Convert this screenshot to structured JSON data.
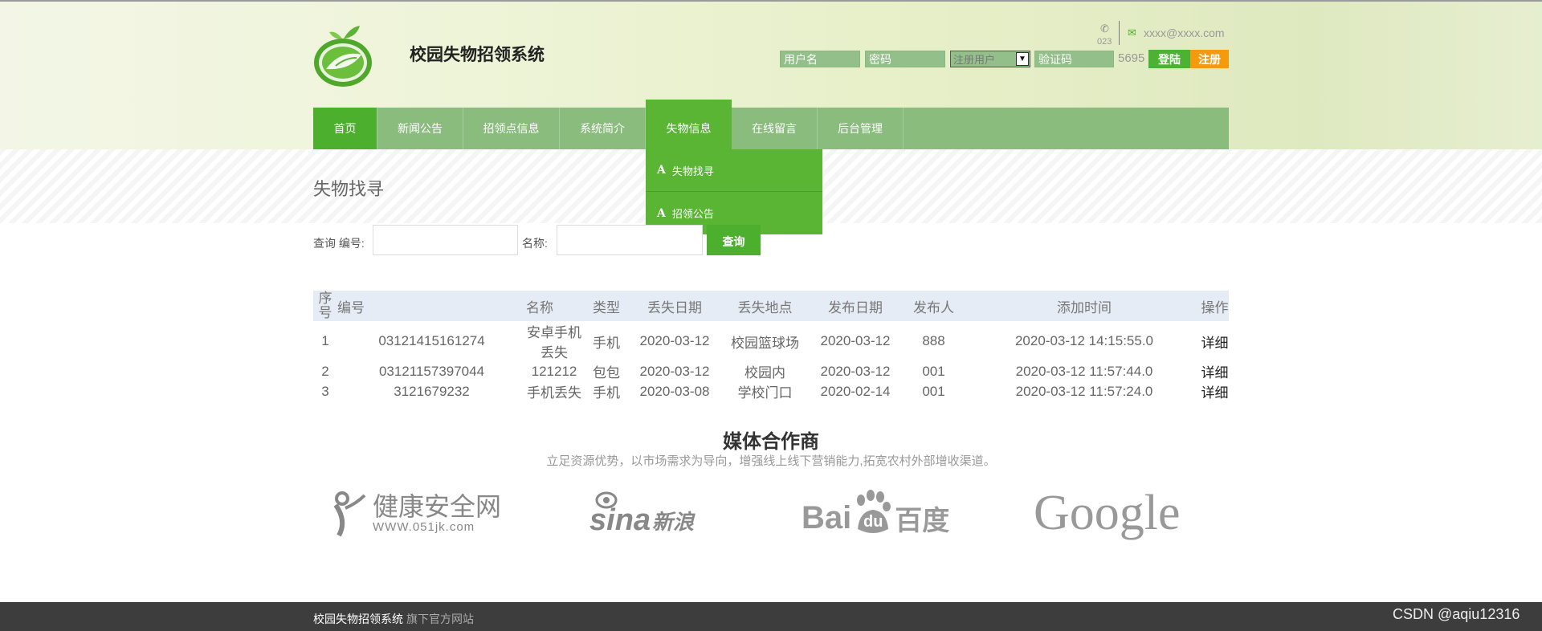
{
  "header": {
    "site_title": "校园失物招领系统",
    "phone_text": "023",
    "email": "xxxx@xxxx.com"
  },
  "login": {
    "username_placeholder": "用户名",
    "password_placeholder": "密码",
    "role_selected": "注册用户",
    "captcha_placeholder": "验证码",
    "captcha_code": "5695",
    "login_label": "登陆",
    "register_label": "注册"
  },
  "nav": {
    "items": [
      "首页",
      "新闻公告",
      "招领点信息",
      "系统简介",
      "失物信息",
      "在线留言",
      "后台管理"
    ],
    "dropdown": [
      "失物找寻",
      "招领公告"
    ]
  },
  "main": {
    "section_title": "失物找寻",
    "search": {
      "label_query_id": "查询 编号:",
      "label_name": "名称:",
      "button": "查询"
    },
    "table": {
      "headers": [
        "序号",
        "编号",
        "名称",
        "类型",
        "丢失日期",
        "丢失地点",
        "发布日期",
        "发布人",
        "添加时间",
        "操作"
      ],
      "rows": [
        [
          "1",
          "03121415161274",
          "安卓手机丢失",
          "手机",
          "2020-03-12",
          "校园篮球场",
          "2020-03-12",
          "888",
          "2020-03-12 14:15:55.0",
          "详细"
        ],
        [
          "2",
          "03121157397044",
          "121212",
          "包包",
          "2020-03-12",
          "校园内",
          "2020-03-12",
          "001",
          "2020-03-12 11:57:44.0",
          "详细"
        ],
        [
          "3",
          "3121679232",
          "手机丢失",
          "手机",
          "2020-03-08",
          "学校门口",
          "2020-02-14",
          "001",
          "2020-03-12 11:57:24.0",
          "详细"
        ]
      ]
    }
  },
  "partners": {
    "title": "媒体合作商",
    "subtitle": "立足资源优势，以市场需求为导向，增强线上线下营销能力,拓宽农村外部增收渠道。",
    "logos": [
      {
        "name": "健康安全网",
        "sub": "WWW.051jk.com"
      },
      {
        "name": "sina",
        "sub": "新浪"
      },
      {
        "name": "Bai",
        "mid": "du",
        "sub": "百度"
      },
      {
        "name": "Google"
      }
    ]
  },
  "footer": {
    "name": "校园失物招领系统",
    "sub": "旗下官方网站",
    "watermark": "CSDN @aqiu12316"
  },
  "colors": {
    "accent_green": "#4caf2e",
    "nav_green": "#8abc7d",
    "register_orange": "#f39a0e",
    "footer_bg": "#3d3d3d"
  }
}
